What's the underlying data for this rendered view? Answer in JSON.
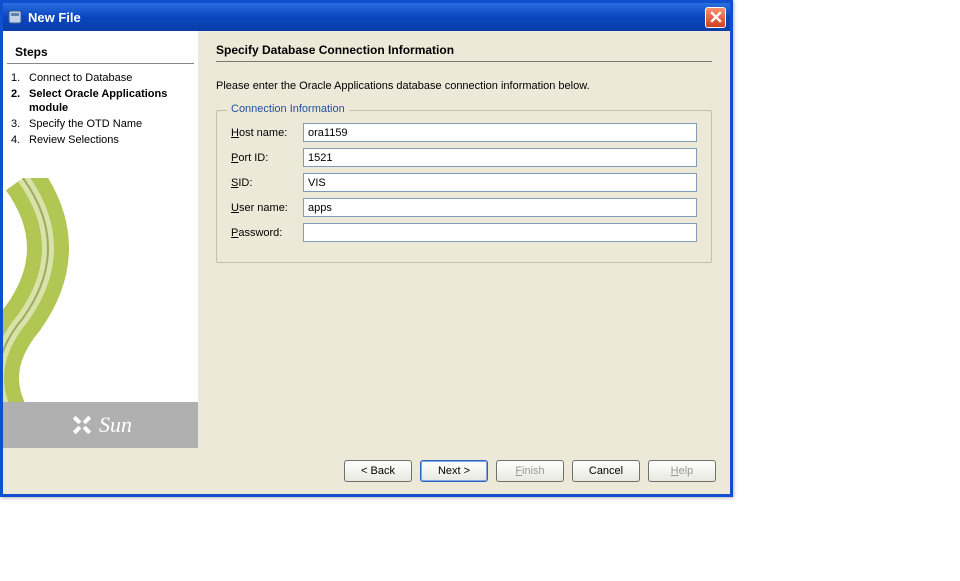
{
  "window": {
    "title": "New File"
  },
  "steps": {
    "header": "Steps",
    "items": [
      {
        "num": "1.",
        "label": "Connect to Database",
        "current": false
      },
      {
        "num": "2.",
        "label": "Select Oracle Applications module",
        "current": true
      },
      {
        "num": "3.",
        "label": "Specify the OTD Name",
        "current": false
      },
      {
        "num": "4.",
        "label": "Review Selections",
        "current": false
      }
    ]
  },
  "sun_logo_text": "Sun",
  "main": {
    "heading": "Specify Database Connection Information",
    "instruction": "Please enter the Oracle Applications database connection information below.",
    "fieldset_legend": "Connection Information",
    "fields": {
      "hostname": {
        "label_pre": "H",
        "label_rest": "ost name:",
        "value": "ora1159"
      },
      "portid": {
        "label_pre": "P",
        "label_rest": "ort ID:",
        "value": "1521"
      },
      "sid": {
        "label_pre": "S",
        "label_rest": "ID:",
        "value": "VIS"
      },
      "username": {
        "label_pre": "U",
        "label_rest": "ser name:",
        "value": "apps"
      },
      "password": {
        "label_pre": "P",
        "label_rest": "assword:",
        "value": ""
      }
    }
  },
  "buttons": {
    "back": "< Back",
    "next": "Next >",
    "finish_pre": "F",
    "finish_rest": "inish",
    "cancel": "Cancel",
    "help_pre": "H",
    "help_rest": "elp"
  }
}
